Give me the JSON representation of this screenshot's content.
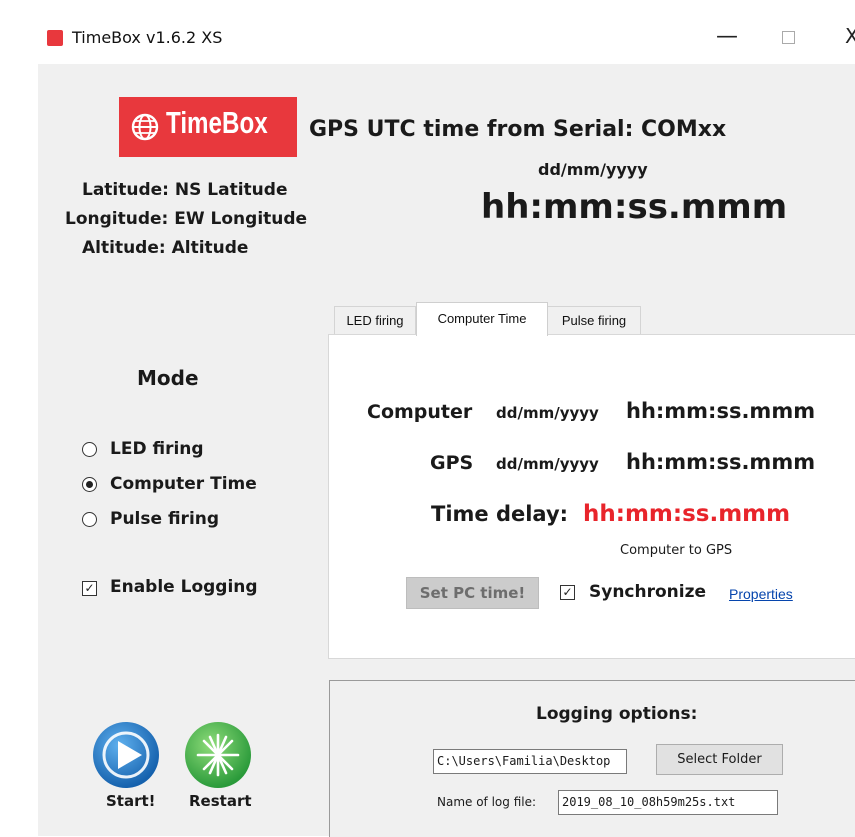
{
  "window": {
    "title": "TimeBox v1.6.2  XS",
    "minimize_glyph": "—",
    "close_glyph": "X"
  },
  "logo": {
    "text": "TimeBox",
    "icon": "globe-icon"
  },
  "gps": {
    "title": "GPS UTC time from Serial: COMxx",
    "date": "dd/mm/yyyy",
    "time": "hh:mm:ss.mmm"
  },
  "coords": {
    "latitude": "Latitude: NS  Latitude",
    "longitude": "Longitude: EW Longitude",
    "altitude": "Altitude:  Altitude"
  },
  "tabs": [
    {
      "label": "LED firing",
      "active": false
    },
    {
      "label": "Computer Time",
      "active": true
    },
    {
      "label": "Pulse firing",
      "active": false
    }
  ],
  "computer_time": {
    "computer_label": "Computer",
    "computer_date": "dd/mm/yyyy",
    "computer_time": "hh:mm:ss.mmm",
    "gps_label": "GPS",
    "gps_date": "dd/mm/yyyy",
    "gps_time": "hh:mm:ss.mmm",
    "delay_label": "Time delay:",
    "delay_value": "hh:mm:ss.mmm",
    "delay_note": "Computer to GPS",
    "set_pc_button": "Set PC time!",
    "synchronize_label": "Synchronize",
    "synchronize_checked": true,
    "properties_link": "Properties",
    "delay_color": "#e8242b"
  },
  "mode": {
    "title": "Mode",
    "options": [
      {
        "label": "LED firing",
        "selected": false
      },
      {
        "label": "Computer Time",
        "selected": true
      },
      {
        "label": "Pulse firing",
        "selected": false
      }
    ],
    "enable_logging_label": "Enable Logging",
    "enable_logging_checked": true
  },
  "logging": {
    "title": "Logging options:",
    "folder_value": "C:\\Users\\Familia\\Desktop",
    "select_folder_button": "Select Folder",
    "log_file_label": "Name of log file:",
    "log_file_value": "2019_08_10_08h59m25s.txt"
  },
  "actions": {
    "start_label": "Start!",
    "restart_label": "Restart",
    "start_icon": "play-icon",
    "restart_icon": "burst-icon"
  },
  "colors": {
    "brand_red": "#e8383d",
    "start_blue": "#1f78c8",
    "restart_green": "#39b54a"
  }
}
